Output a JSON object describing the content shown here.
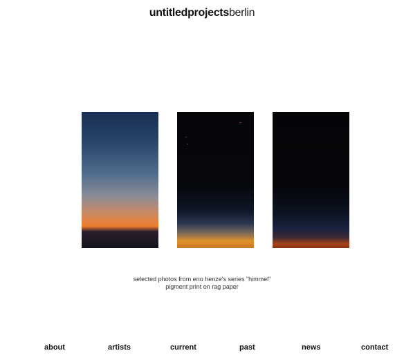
{
  "header": {
    "logo_bold": "untitledprojects",
    "logo_light": "berlin"
  },
  "gallery": {
    "caption_line1": "selected photos from eno henze's series \"himmel\"",
    "caption_line2": "pigment print on rag paper"
  },
  "nav": {
    "about": "about",
    "artists": "artists",
    "current": "current",
    "past": "past",
    "news": "news",
    "contact": "contact"
  }
}
